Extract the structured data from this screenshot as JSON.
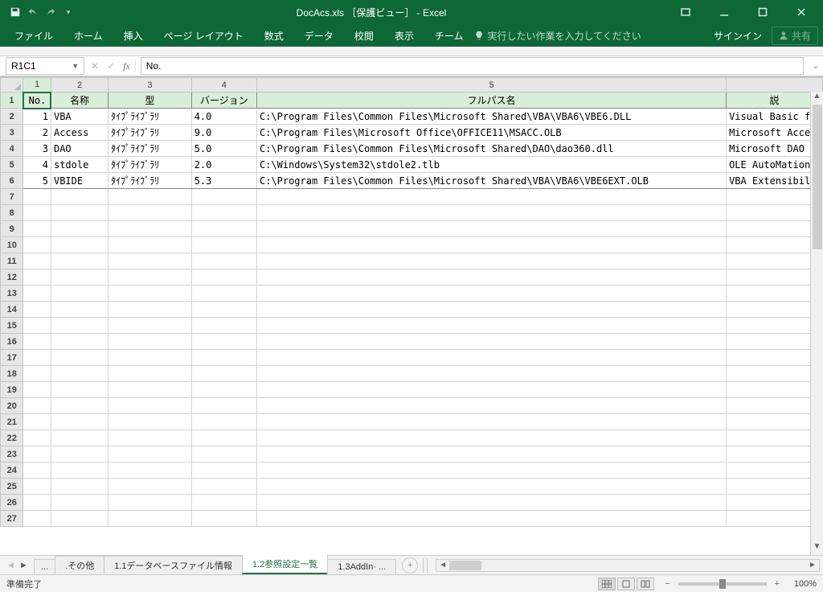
{
  "title": "DocAcs.xls ［保護ビュー］ - Excel",
  "ribbon": {
    "tabs": [
      "ファイル",
      "ホーム",
      "挿入",
      "ページ レイアウト",
      "数式",
      "データ",
      "校閲",
      "表示",
      "チーム"
    ],
    "tellme": "実行したい作業を入力してください",
    "signin": "サインイン",
    "share": "共有"
  },
  "namebox": "R1C1",
  "formula": "No.",
  "columns": {
    "labels": [
      "1",
      "2",
      "3",
      "4",
      "5"
    ],
    "widths": [
      34,
      70,
      102,
      80,
      575,
      118
    ]
  },
  "header_row": [
    "No.",
    "名称",
    "型",
    "バージョン",
    "フルパス名",
    "説"
  ],
  "rows": [
    {
      "no": "1",
      "name": "VBA",
      "type": "ﾀｲﾌﾟﾗｲﾌﾞﾗﾘ",
      "ver": "4.0",
      "path": "C:\\Program Files\\Common Files\\Microsoft Shared\\VBA\\VBA6\\VBE6.DLL",
      "desc": "Visual Basic f"
    },
    {
      "no": "2",
      "name": "Access",
      "type": "ﾀｲﾌﾟﾗｲﾌﾞﾗﾘ",
      "ver": "9.0",
      "path": "C:\\Program Files\\Microsoft Office\\OFFICE11\\MSACC.OLB",
      "desc": "Microsoft Acce"
    },
    {
      "no": "3",
      "name": "DAO",
      "type": "ﾀｲﾌﾟﾗｲﾌﾞﾗﾘ",
      "ver": "5.0",
      "path": "C:\\Program Files\\Common Files\\Microsoft Shared\\DAO\\dao360.dll",
      "desc": "Microsoft DAO "
    },
    {
      "no": "4",
      "name": "stdole",
      "type": "ﾀｲﾌﾟﾗｲﾌﾞﾗﾘ",
      "ver": "2.0",
      "path": "C:\\Windows\\System32\\stdole2.tlb",
      "desc": "OLE AutoMation"
    },
    {
      "no": "5",
      "name": "VBIDE",
      "type": "ﾀｲﾌﾟﾗｲﾌﾞﾗﾘ",
      "ver": "5.3",
      "path": "C:\\Program Files\\Common Files\\Microsoft Shared\\VBA\\VBA6\\VBE6EXT.OLB",
      "desc": "VBA Extensibil"
    }
  ],
  "empty_rows": 21,
  "sheet_tabs": {
    "dots": "...",
    "items": [
      ".その他",
      "1.1データベースファイル情報",
      "1.2参照設定一覧",
      "1.3AddIn· ..."
    ],
    "active_index": 2
  },
  "status": {
    "ready": "準備完了",
    "zoom": "100%"
  }
}
